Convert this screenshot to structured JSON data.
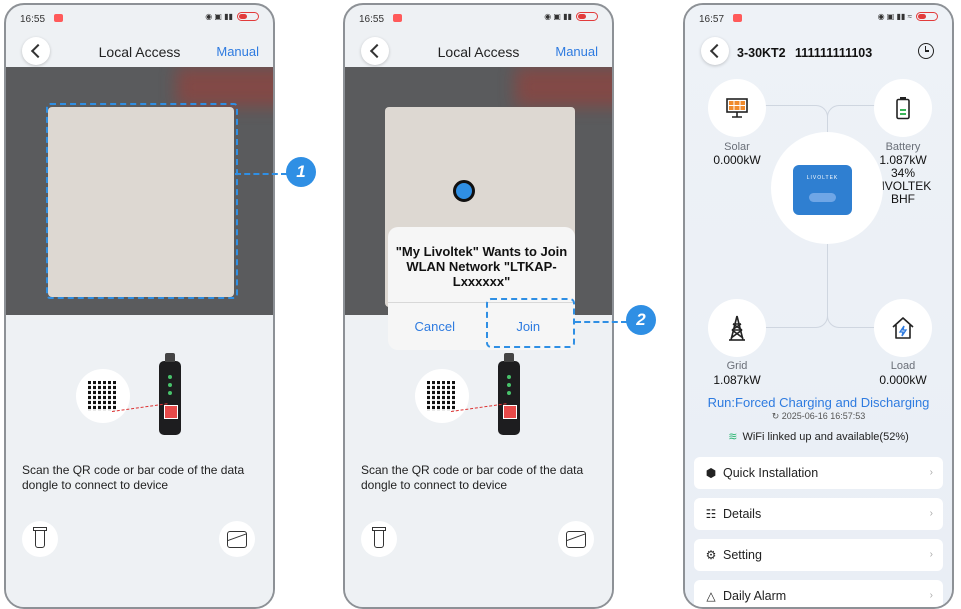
{
  "colors": {
    "accent": "#2e7be0",
    "callout": "#2f8fe4",
    "battery_icon": "#3cb55a",
    "wifi_icon": "#2bb673"
  },
  "screen1": {
    "status_time": "16:55",
    "nav": {
      "title": "Local Access",
      "manual": "Manual"
    },
    "scan_text": "Scan the QR code or bar code of the data dongle to connect to device",
    "callout": "1",
    "icons": [
      "back-icon",
      "flashlight-icon",
      "gallery-icon"
    ]
  },
  "screen2": {
    "status_time": "16:55",
    "nav": {
      "title": "Local Access",
      "manual": "Manual"
    },
    "dialog": {
      "message": "\"My Livoltek\" Wants to Join WLAN Network \"LTKAP-Lxxxxxx\"",
      "cancel": "Cancel",
      "join": "Join"
    },
    "scan_text": "Scan the QR code or bar code of the data dongle to connect to device",
    "callout": "2"
  },
  "screen3": {
    "status_time": "16:57",
    "model": "3-30KT2",
    "serial": "111111111103",
    "solar": {
      "label": "Solar",
      "value": "0.000kW"
    },
    "battery": {
      "label": "Battery",
      "value": "1.087kW",
      "percent": "34%",
      "brand": "LIVOLTEK",
      "type": "BHF"
    },
    "device_brand": "LIVOLTEK",
    "grid": {
      "label": "Grid",
      "value": "1.087kW"
    },
    "load": {
      "label": "Load",
      "value": "0.000kW"
    },
    "run_status": "Run:Forced Charging and Discharging",
    "timestamp": "2025-06-16 16:57:53",
    "wifi": "WiFi linked up and available(52%)",
    "menu": [
      "Quick Installation",
      "Details",
      "Setting",
      "Daily Alarm"
    ]
  }
}
